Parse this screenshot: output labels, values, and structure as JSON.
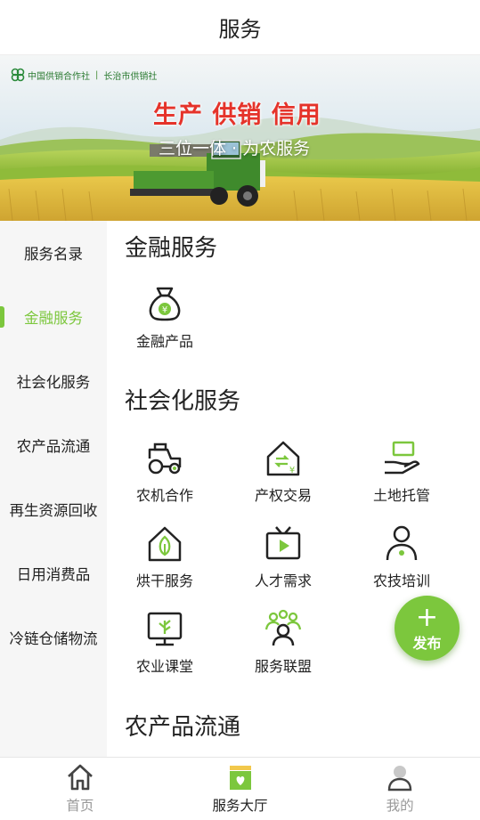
{
  "header": {
    "title": "服务"
  },
  "banner": {
    "logo_text": "中国供销合作社",
    "logo_sub": "长治市供销社",
    "slogan": "生产 供销 信用",
    "subslogan": "三位一体 · 为农服务"
  },
  "sidebar": {
    "items": [
      {
        "label": "服务名录"
      },
      {
        "label": "金融服务"
      },
      {
        "label": "社会化服务"
      },
      {
        "label": "农产品流通"
      },
      {
        "label": "再生资源回收"
      },
      {
        "label": "日用消费品"
      },
      {
        "label": "冷链仓储物流"
      }
    ],
    "active_index": 1
  },
  "sections": [
    {
      "title": "金融服务",
      "services": [
        {
          "label": "金融产品",
          "icon": "money-bag-icon"
        }
      ]
    },
    {
      "title": "社会化服务",
      "services": [
        {
          "label": "农机合作",
          "icon": "tractor-icon"
        },
        {
          "label": "产权交易",
          "icon": "house-exchange-icon"
        },
        {
          "label": "土地托管",
          "icon": "hand-land-icon"
        },
        {
          "label": "烘干服务",
          "icon": "house-leaf-icon"
        },
        {
          "label": "人才需求",
          "icon": "tv-play-icon"
        },
        {
          "label": "农技培训",
          "icon": "person-icon"
        },
        {
          "label": "农业课堂",
          "icon": "monitor-plant-icon"
        },
        {
          "label": "服务联盟",
          "icon": "group-icon"
        }
      ]
    },
    {
      "title": "农产品流通",
      "services": []
    }
  ],
  "fab": {
    "label": "发布"
  },
  "tabbar": {
    "items": [
      {
        "label": "首页",
        "icon": "home-icon"
      },
      {
        "label": "服务大厅",
        "icon": "service-hall-icon"
      },
      {
        "label": "我的",
        "icon": "user-icon"
      }
    ],
    "active_index": 1
  },
  "colors": {
    "accent": "#7cc73d",
    "slogan_red": "#e5332a",
    "sidebar_bg": "#f6f6f6"
  }
}
